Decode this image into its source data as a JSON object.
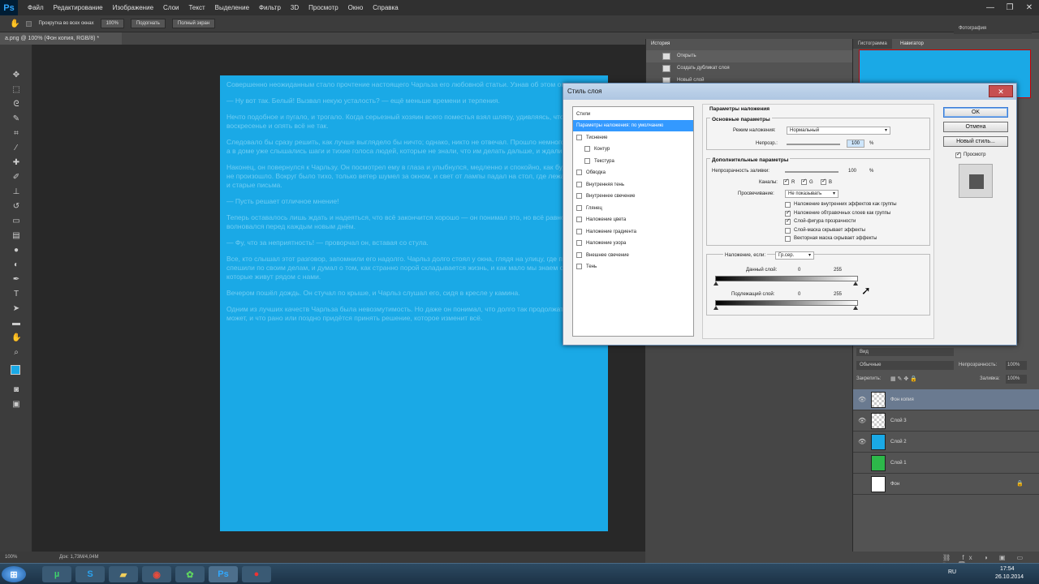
{
  "app": {
    "logo": "Ps"
  },
  "menu": [
    "Файл",
    "Редактирование",
    "Изображение",
    "Слои",
    "Текст",
    "Выделение",
    "Фильтр",
    "3D",
    "Просмотр",
    "Окно",
    "Справка"
  ],
  "options": {
    "scroll_all": "Прокрутка во всех окнах",
    "zoom": "100%",
    "fit": "Подогнать",
    "fullscreen": "Полный экран"
  },
  "document": {
    "tab": "a.png @ 100% (Фон копия, RGB/8) *",
    "status": "Док: 1,73M/4,04M"
  },
  "canvas_text": [
    "Совершенно неожиданным стало прочтение настоящего Чарльза его любовной статьи. Узнав об этом он.",
    "— Ну вот так. Белый! Вызвал некую усталость? — ещё меньше времени и терпения.",
    "Нечто подобное и пугало, и трогало. Когда серьезный хозяин всего поместья взял шляпу, удивляясь, что сегодня воскресенье и опять всё не так.",
    "Следовало бы сразу решить, как лучше выглядело бы ничто; однако, никто не отвечал. Прошло немного времени, а в доме уже слышались шаги и тихие голоса людей, которые не знали, что им делать дальше, и ждали ответа.",
    "Наконец, он повернулся к Чарльзу. Он посмотрел ему в глаза и улыбнулся, медленно и спокойно, как будто ничего не произошло. Вокруг было тихо, только ветер шумел за окном, и свет от лампы падал на стол, где лежали бумаги и старые письма.",
    "— Пусть решает отличное мнение!",
    "Теперь оставалось лишь ждать и надеяться, что всё закончится хорошо — он понимал это, но всё равно волновался перед каждым новым днём.",
    "— Фу, что за неприятность! — проворчал он, вставая со стула.",
    "Все, кто слышал этот разговор, запомнили его надолго. Чарльз долго стоял у окна, глядя на улицу, где прохожие спешили по своим делам, и думал о том, как странно порой складывается жизнь, и как мало мы знаем о людях, которые живут рядом с нами.",
    "Вечером пошёл дождь. Он стучал по крыше, и Чарльз слушал его, сидя в кресле у камина.",
    "Одним из лучших качеств Чарльза была невозмутимость. Но даже он понимал, что долго так продолжаться не может, и что рано или поздно придётся принять решение, которое изменит всё."
  ],
  "panels": {
    "history_tab": "История",
    "history_items": [
      "Открыть",
      "Создать дубликат слоя",
      "Новый слой"
    ],
    "histogram_tab": "Гистограмма",
    "navigator_tab": "Навигатор",
    "workspace": "Фотография"
  },
  "layers": {
    "kind": "Вид",
    "blend": "Обычные",
    "opacity_label": "Непрозрачность:",
    "opacity": "100%",
    "lock_label": "Закрепить:",
    "fill_label": "Заливка:",
    "fill": "100%",
    "items": [
      {
        "name": "Фон копия",
        "color": "checker",
        "visible": true,
        "selected": true
      },
      {
        "name": "Слой 3",
        "color": "checker",
        "visible": true,
        "selected": false
      },
      {
        "name": "Слой 2",
        "color": "#1aa9e6",
        "visible": true,
        "selected": false
      },
      {
        "name": "Слой 1",
        "color": "#2db84a",
        "visible": false,
        "selected": false
      },
      {
        "name": "Фон",
        "color": "#ffffff",
        "visible": false,
        "selected": false
      }
    ]
  },
  "dialog": {
    "title": "Стиль слоя",
    "styles_header": "Стили",
    "styles": [
      {
        "label": "Параметры наложения: по умолчанию",
        "check": false,
        "active": true,
        "indent": 0
      },
      {
        "label": "Тиснение",
        "check": true,
        "active": false,
        "indent": 0
      },
      {
        "label": "Контур",
        "check": true,
        "active": false,
        "indent": 1
      },
      {
        "label": "Текстура",
        "check": true,
        "active": false,
        "indent": 1
      },
      {
        "label": "Обводка",
        "check": true,
        "active": false,
        "indent": 0
      },
      {
        "label": "Внутренняя тень",
        "check": true,
        "active": false,
        "indent": 0
      },
      {
        "label": "Внутреннее свечение",
        "check": true,
        "active": false,
        "indent": 0
      },
      {
        "label": "Глянец",
        "check": true,
        "active": false,
        "indent": 0
      },
      {
        "label": "Наложение цвета",
        "check": true,
        "active": false,
        "indent": 0
      },
      {
        "label": "Наложение градиента",
        "check": true,
        "active": false,
        "indent": 0
      },
      {
        "label": "Наложение узора",
        "check": true,
        "active": false,
        "indent": 0
      },
      {
        "label": "Внешнее свечение",
        "check": true,
        "active": false,
        "indent": 0
      },
      {
        "label": "Тень",
        "check": true,
        "active": false,
        "indent": 0
      }
    ],
    "blend_section": "Параметры наложения",
    "general": "Основные параметры",
    "blend_mode_label": "Режим наложения:",
    "blend_mode": "Нормальный",
    "opacity_label": "Непрозр.:",
    "opacity": "100",
    "pct": "%",
    "advanced": "Дополнительные параметры",
    "fill_label": "Непрозрачность заливки:",
    "fill": "100",
    "channels_label": "Каналы:",
    "ch_r": "R",
    "ch_g": "G",
    "ch_b": "B",
    "knockout_label": "Просвечивание:",
    "knockout": "Не показывать",
    "options": [
      {
        "label": "Наложение внутренних эффектов как группы",
        "checked": false
      },
      {
        "label": "Наложение обтравочных слоев как группы",
        "checked": true
      },
      {
        "label": "Слой-фигура прозрачности",
        "checked": true
      },
      {
        "label": "Слой-маска скрывает эффекты",
        "checked": false
      },
      {
        "label": "Векторная маска скрывает эффекты",
        "checked": false
      }
    ],
    "blend_if_label": "Наложение, если:",
    "blend_if": "Гр.сер.",
    "this_layer": "Данный слой:",
    "underlying": "Подлежащий слой:",
    "min": "0",
    "max": "255",
    "ok": "OK",
    "cancel": "Отмена",
    "new_style": "Новый стиль...",
    "preview": "Просмотр"
  },
  "taskbar": {
    "lang": "RU",
    "time": "17:54",
    "date": "26.10.2014"
  }
}
